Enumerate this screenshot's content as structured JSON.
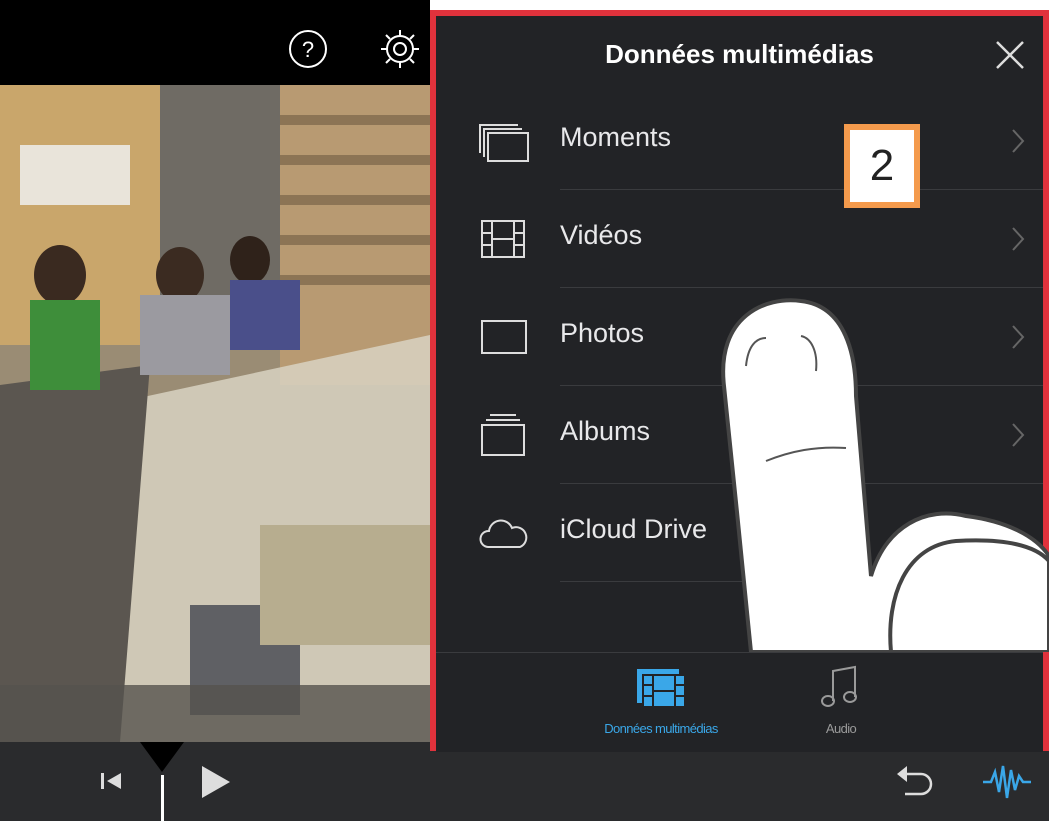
{
  "top_bar": {
    "icons": [
      "help-icon",
      "settings-icon"
    ]
  },
  "media_panel": {
    "title": "Données multimédias",
    "rows": [
      {
        "label": "Moments",
        "icon": "moments-icon"
      },
      {
        "label": "Vidéos",
        "icon": "film-icon"
      },
      {
        "label": "Photos",
        "icon": "photo-icon"
      },
      {
        "label": "Albums",
        "icon": "albums-icon"
      },
      {
        "label": "iCloud Drive",
        "icon": "cloud-icon"
      }
    ],
    "step_badge": "2",
    "tabs": [
      {
        "label": "Données multimédias",
        "icon": "media-library-icon",
        "active": true
      },
      {
        "label": "Audio",
        "icon": "music-note-icon",
        "active": false
      }
    ],
    "highlight_color": "#e0323c",
    "active_tab_color": "#3aa7e8"
  },
  "bottom_bar": {
    "controls": [
      "skip-to-start-icon",
      "play-icon",
      "undo-icon",
      "audio-waveform-icon"
    ]
  }
}
